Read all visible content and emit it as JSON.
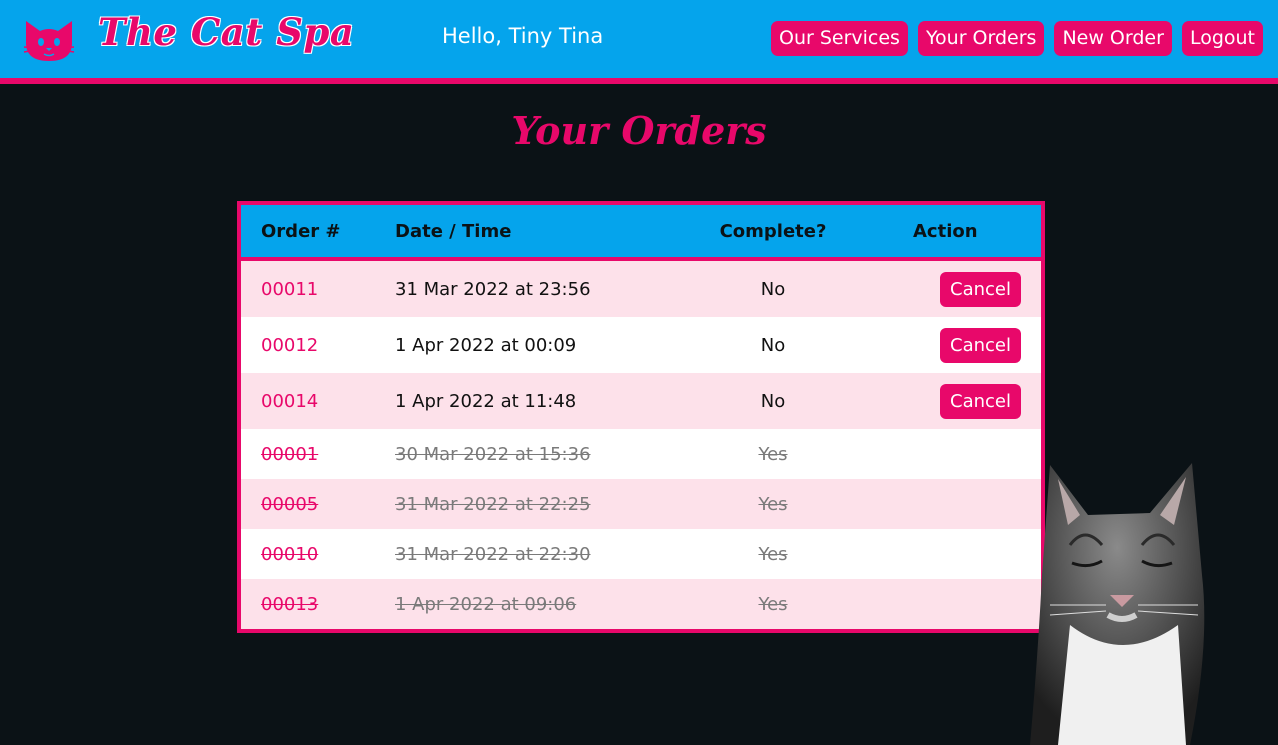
{
  "header": {
    "brand": "The Cat Spa",
    "greeting": "Hello, Tiny Tina",
    "nav": [
      "Our Services",
      "Your Orders",
      "New Order",
      "Logout"
    ],
    "logo_icon": "cat-face-icon",
    "colors": {
      "bar": "#05a4ec",
      "accent": "#e8086a",
      "background": "#0b1216"
    }
  },
  "page": {
    "title": "Your Orders"
  },
  "table": {
    "headers": [
      "Order #",
      "Date / Time",
      "Complete?",
      "Action"
    ],
    "rows": [
      {
        "order": "00011",
        "datetime": "31 Mar 2022 at 23:56",
        "complete": "No",
        "action": "Cancel"
      },
      {
        "order": "00012",
        "datetime": "1 Apr 2022 at 00:09",
        "complete": "No",
        "action": "Cancel"
      },
      {
        "order": "00014",
        "datetime": "1 Apr 2022 at 11:48",
        "complete": "No",
        "action": "Cancel"
      },
      {
        "order": "00001",
        "datetime": "30 Mar 2022 at 15:36",
        "complete": "Yes",
        "action": ""
      },
      {
        "order": "00005",
        "datetime": "31 Mar 2022 at 22:25",
        "complete": "Yes",
        "action": ""
      },
      {
        "order": "00010",
        "datetime": "31 Mar 2022 at 22:30",
        "complete": "Yes",
        "action": ""
      },
      {
        "order": "00013",
        "datetime": "1 Apr 2022 at 09:06",
        "complete": "Yes",
        "action": ""
      }
    ]
  }
}
